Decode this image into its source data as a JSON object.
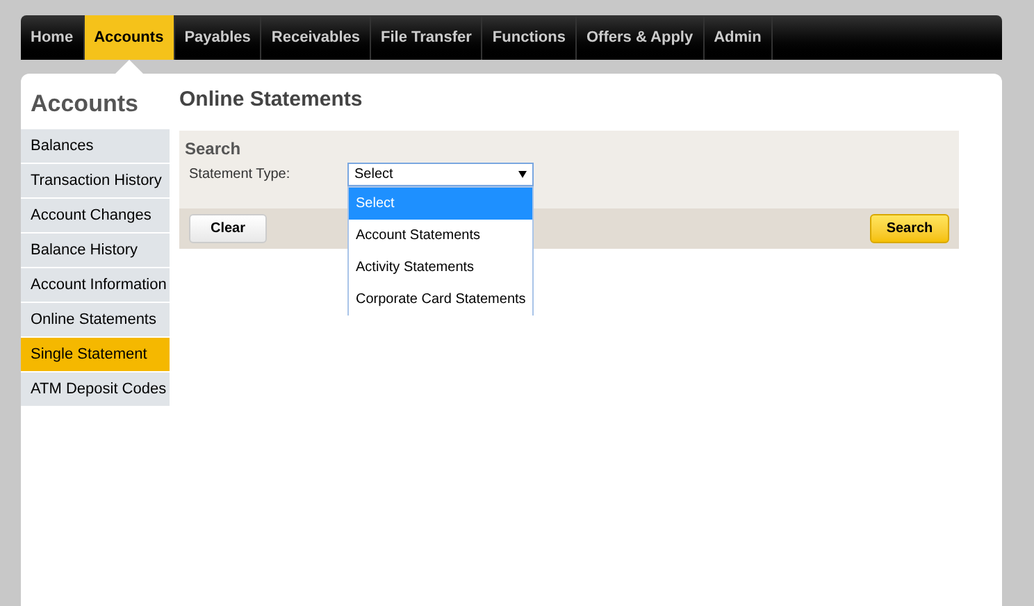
{
  "nav": [
    {
      "label": "Home",
      "selected": false
    },
    {
      "label": "Accounts",
      "selected": true
    },
    {
      "label": "Payables",
      "selected": false
    },
    {
      "label": "Receivables",
      "selected": false
    },
    {
      "label": "File Transfer",
      "selected": false
    },
    {
      "label": "Functions",
      "selected": false
    },
    {
      "label": "Offers & Apply",
      "selected": false
    },
    {
      "label": "Admin",
      "selected": false
    }
  ],
  "sidebar": {
    "title": "Accounts",
    "items": [
      {
        "label": "Balances",
        "selected": false
      },
      {
        "label": "Transaction History",
        "selected": false
      },
      {
        "label": "Account Changes",
        "selected": false
      },
      {
        "label": "Balance History",
        "selected": false
      },
      {
        "label": "Account Information",
        "selected": false
      },
      {
        "label": "Online Statements",
        "selected": false
      },
      {
        "label": "Single Statement",
        "selected": true
      },
      {
        "label": "ATM Deposit Codes",
        "selected": false
      }
    ]
  },
  "page_title": "Online Statements",
  "search": {
    "title": "Search",
    "field_label": "Statement Type:",
    "value": "Select",
    "options": [
      {
        "label": "Select",
        "selected": true
      },
      {
        "label": "Account Statements",
        "selected": false
      },
      {
        "label": "Activity Statements",
        "selected": false
      },
      {
        "label": "Corporate Card Statements",
        "selected": false
      }
    ],
    "buttons": [
      "Clear",
      "Search"
    ]
  }
}
